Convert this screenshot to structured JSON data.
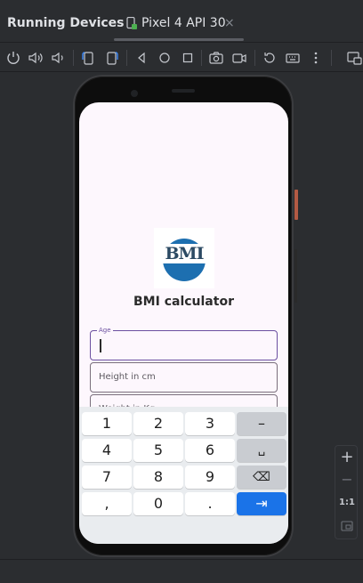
{
  "header": {
    "panel_title": "Running Devices",
    "tab": {
      "label": "Pixel 4 API 30",
      "close": "×"
    }
  },
  "toolbar": {
    "icons": [
      "power-icon",
      "volume-up-icon",
      "volume-down-icon",
      "rotate-left-icon",
      "rotate-right-icon",
      "back-icon",
      "home-icon",
      "overview-icon",
      "camera-icon",
      "video-icon",
      "reset-icon",
      "keyboard-icon",
      "more-icon",
      "window-icon"
    ]
  },
  "app": {
    "logo_text": "BMI",
    "title": "BMI calculator",
    "fields": {
      "age": {
        "label": "Age",
        "value": ""
      },
      "height": {
        "placeholder": "Height in cm"
      },
      "weight": {
        "placeholder": "Weight in Kg"
      }
    }
  },
  "keyboard": {
    "row1": [
      "1",
      "2",
      "3",
      "–"
    ],
    "row2": [
      "4",
      "5",
      "6",
      "␣"
    ],
    "row3": [
      "7",
      "8",
      "9",
      "⌫"
    ],
    "row4": [
      ",",
      "0",
      ".",
      "⇥"
    ]
  },
  "side": {
    "zoom_in": "+",
    "zoom_out": "−",
    "actual_size": "1:1"
  },
  "colors": {
    "accent": "#1a73e8",
    "focus": "#6b4fa0",
    "logo_blue": "#1d6fb0"
  }
}
